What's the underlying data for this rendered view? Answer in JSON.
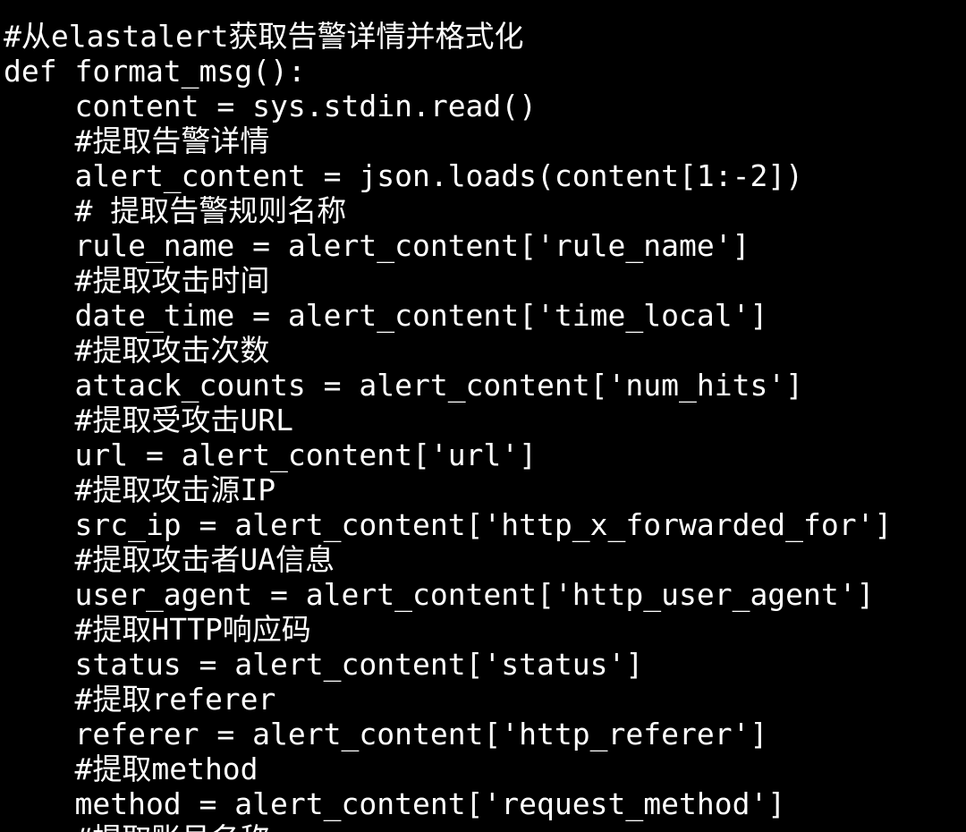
{
  "terminal": {
    "background": "#000000",
    "text_color": "#ffffff",
    "lines": [
      "#从elastalert获取告警详情并格式化",
      "def format_msg():",
      "    content = sys.stdin.read()",
      "    #提取告警详情",
      "    alert_content = json.loads(content[1:-2])",
      "    # 提取告警规则名称",
      "    rule_name = alert_content['rule_name']",
      "    #提取攻击时间",
      "    date_time = alert_content['time_local']",
      "    #提取攻击次数",
      "    attack_counts = alert_content['num_hits']",
      "    #提取受攻击URL",
      "    url = alert_content['url']",
      "    #提取攻击源IP",
      "    src_ip = alert_content['http_x_forwarded_for']",
      "    #提取攻击者UA信息",
      "    user_agent = alert_content['http_user_agent']",
      "    #提取HTTP响应码",
      "    status = alert_content['status']",
      "    #提取referer",
      "    referer = alert_content['http_referer']",
      "    #提取method",
      "    method = alert_content['request_method']",
      "    #提取账号名称"
    ]
  }
}
